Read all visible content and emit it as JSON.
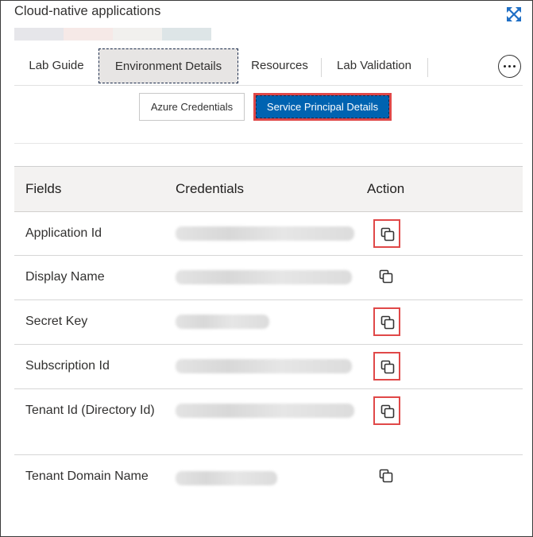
{
  "window": {
    "title": "Cloud-native applications"
  },
  "colorbar": [
    "#e6e6ea",
    "#f6e9e7",
    "#f1f0ee",
    "#dde5e7"
  ],
  "tabs": [
    {
      "label": "Lab Guide",
      "active": false
    },
    {
      "label": "Environment Details",
      "active": true
    },
    {
      "label": "Resources",
      "active": false
    },
    {
      "label": "Lab Validation",
      "active": false
    }
  ],
  "subtabs": {
    "azure": "Azure Credentials",
    "service_principal": "Service Principal Details"
  },
  "table": {
    "headers": {
      "fields": "Fields",
      "credentials": "Credentials",
      "action": "Action"
    },
    "rows": [
      {
        "field": "Application Id",
        "highlight": true
      },
      {
        "field": "Display Name",
        "highlight": false
      },
      {
        "field": "Secret Key",
        "highlight": true
      },
      {
        "field": "Subscription Id",
        "highlight": true
      },
      {
        "field": "Tenant Id (Directory Id)",
        "highlight": true
      },
      {
        "field": "Tenant Domain Name",
        "highlight": false
      }
    ]
  },
  "icons": {
    "expand": "expand-icon",
    "more": "ellipsis-icon",
    "copy": "copy-icon"
  }
}
